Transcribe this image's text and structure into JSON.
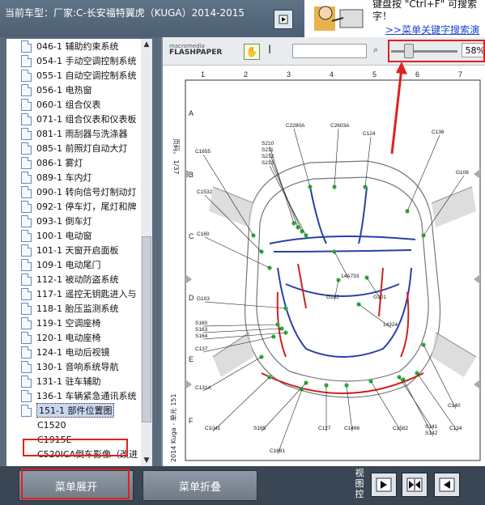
{
  "header": {
    "title_prefix": "当前车型：",
    "title_model": "厂家:C-长安福特翼虎（KUGA）2014-2015"
  },
  "promo": {
    "text": "键盘按 \"Ctrl+F\" 可搜索字！",
    "link": ">>菜单关键字搜索演"
  },
  "tree": {
    "items": [
      {
        "label": "046-1 辅助约束系统",
        "icon": "document-icon"
      },
      {
        "label": "054-1 手动空调控制系统",
        "icon": "document-icon"
      },
      {
        "label": "055-1 自动空调控制系统",
        "icon": "document-icon"
      },
      {
        "label": "056-1 电热窗",
        "icon": "document-icon"
      },
      {
        "label": "060-1 组合仪表",
        "icon": "document-icon"
      },
      {
        "label": "071-1 组合仪表和仪表板",
        "icon": "document-icon"
      },
      {
        "label": "081-1 雨刮器与洗涤器",
        "icon": "document-icon"
      },
      {
        "label": "085-1 前照灯自动大灯",
        "icon": "document-icon"
      },
      {
        "label": "086-1 雾灯",
        "icon": "document-icon"
      },
      {
        "label": "089-1 车内灯",
        "icon": "document-icon"
      },
      {
        "label": "090-1 转向信号灯制动灯",
        "icon": "document-icon"
      },
      {
        "label": "092-1 停车灯，尾灯和牌",
        "icon": "document-icon"
      },
      {
        "label": "093-1 倒车灯",
        "icon": "document-icon"
      },
      {
        "label": "100-1 电动窗",
        "icon": "document-icon"
      },
      {
        "label": "101-1 天窗开启面板",
        "icon": "document-icon"
      },
      {
        "label": "109-1 电动尾门",
        "icon": "document-icon"
      },
      {
        "label": "112-1 被动防盗系统",
        "icon": "document-icon"
      },
      {
        "label": "117-1 遥控无钥匙进入与",
        "icon": "document-icon"
      },
      {
        "label": "118-1 胎压监测系统",
        "icon": "document-icon"
      },
      {
        "label": "119-1 空调座椅",
        "icon": "document-icon"
      },
      {
        "label": "120-1 电动座椅",
        "icon": "document-icon"
      },
      {
        "label": "124-1 电动后视镜",
        "icon": "document-icon"
      },
      {
        "label": "130-1 音响系统导航",
        "icon": "document-icon"
      },
      {
        "label": "131-1 驻车辅助",
        "icon": "document-icon"
      },
      {
        "label": "136-1 车辆紧急通讯系统",
        "icon": "document-icon"
      },
      {
        "label": "151-1 部件位置图",
        "icon": "document-icon",
        "selected": true
      },
      {
        "label": "C1520",
        "icon": "none"
      },
      {
        "label": "C1915E",
        "icon": "none"
      },
      {
        "label": "C520ICA倒车影像（改进",
        "icon": "none"
      }
    ]
  },
  "viewer": {
    "logo_line1": "macromedia",
    "logo_line2": "FLASHPAPER",
    "zoom": "58%",
    "zoom_fraction": 0.2
  },
  "diagram": {
    "col_numbers": [
      "1",
      "2",
      "3",
      "4",
      "5",
      "6",
      "7"
    ],
    "row_letters": [
      "A",
      "B",
      "C",
      "D",
      "E",
      "F"
    ],
    "side_caption": "2014 Kuga - 单元 151",
    "page_caption": "页码， 1/37",
    "labels": [
      "C2280A",
      "C2603A",
      "C124",
      "C136",
      "C1655",
      "S210",
      "S211",
      "S212",
      "S213",
      "G108",
      "C1532",
      "C160",
      "14A733",
      "G103",
      "G102",
      "G101",
      "S160",
      "S163",
      "S164",
      "14324",
      "C137",
      "C131A",
      "C140",
      "C1041",
      "S165",
      "C127",
      "C1466",
      "C1582",
      "S141",
      "S142",
      "C134",
      "C1681"
    ]
  },
  "bottom": {
    "expand_label": "菜单展开",
    "collapse_label": "菜单折叠",
    "view_label": "视图控"
  },
  "colors": {
    "accent_red": "#e02020",
    "wire_blue": "#2a3fa8",
    "wire_red": "#cc2222",
    "wire_green": "#2fae3a"
  }
}
